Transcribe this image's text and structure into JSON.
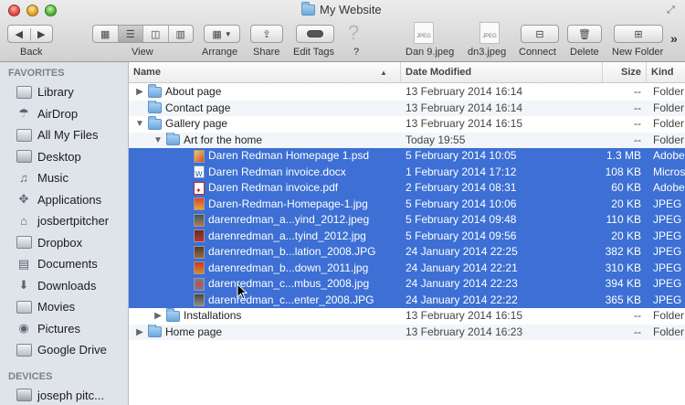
{
  "window": {
    "title": "My Website"
  },
  "toolbar": {
    "back_label": "Back",
    "view_label": "View",
    "arrange_label": "Arrange",
    "share_label": "Share",
    "tags_label": "Edit Tags",
    "help_label": "?",
    "thumb1_label": "Dan 9.jpeg",
    "thumb2_label": "dn3.jpeg",
    "connect_label": "Connect",
    "delete_label": "Delete",
    "newfolder_label": "New Folder",
    "more_glyph": "»"
  },
  "sidebar": {
    "favorites_heading": "FAVORITES",
    "devices_heading": "DEVICES",
    "items": [
      {
        "label": "Library",
        "icon": "folder-icon"
      },
      {
        "label": "AirDrop",
        "icon": "airdrop-icon"
      },
      {
        "label": "All My Files",
        "icon": "all-files-icon"
      },
      {
        "label": "Desktop",
        "icon": "desktop-icon"
      },
      {
        "label": "Music",
        "icon": "music-icon"
      },
      {
        "label": "Applications",
        "icon": "applications-icon"
      },
      {
        "label": "josbertpitcher",
        "icon": "home-icon"
      },
      {
        "label": "Dropbox",
        "icon": "folder-icon"
      },
      {
        "label": "Documents",
        "icon": "documents-icon"
      },
      {
        "label": "Downloads",
        "icon": "downloads-icon"
      },
      {
        "label": "Movies",
        "icon": "movies-icon"
      },
      {
        "label": "Pictures",
        "icon": "pictures-icon"
      },
      {
        "label": "Google Drive",
        "icon": "folder-icon"
      }
    ],
    "devices": [
      {
        "label": "joseph pitc...",
        "icon": "computer-icon"
      }
    ]
  },
  "columns": {
    "name": "Name",
    "date": "Date Modified",
    "size": "Size",
    "kind": "Kind"
  },
  "rows": [
    {
      "name": "About page",
      "date": "13 February 2014 16:14",
      "size": "--",
      "kind": "Folder",
      "level": 0,
      "type": "folder",
      "disclosure": "closed",
      "selected": false
    },
    {
      "name": "Contact page",
      "date": "13 February 2014 16:14",
      "size": "--",
      "kind": "Folder",
      "level": 0,
      "type": "folder",
      "disclosure": "none",
      "selected": false
    },
    {
      "name": "Gallery page",
      "date": "13 February 2014 16:15",
      "size": "--",
      "kind": "Folder",
      "level": 0,
      "type": "folder",
      "disclosure": "open",
      "selected": false
    },
    {
      "name": "Art for the home",
      "date": "Today 19:55",
      "size": "--",
      "kind": "Folder",
      "level": 1,
      "type": "folder",
      "disclosure": "open",
      "selected": false
    },
    {
      "name": "Daren Redman Homepage 1.psd",
      "date": "5 February 2014 10:05",
      "size": "1.3 MB",
      "kind": "Adobe",
      "level": 2,
      "type": "psd",
      "selected": true
    },
    {
      "name": "Daren Redman invoice.docx",
      "date": "1 February 2014 17:12",
      "size": "108 KB",
      "kind": "Micros",
      "level": 2,
      "type": "docx",
      "selected": true
    },
    {
      "name": "Daren Redman invoice.pdf",
      "date": "2 February 2014 08:31",
      "size": "60 KB",
      "kind": "Adobe",
      "level": 2,
      "type": "pdf",
      "selected": true
    },
    {
      "name": "Daren-Redman-Homepage-1.jpg",
      "date": "5 February 2014 10:06",
      "size": "20 KB",
      "kind": "JPEG in",
      "level": 2,
      "type": "jpg1",
      "selected": true
    },
    {
      "name": "darenredman_a...yind_2012.jpeg",
      "date": "5 February 2014 09:48",
      "size": "110 KB",
      "kind": "JPEG in",
      "level": 2,
      "type": "jpg2",
      "selected": true
    },
    {
      "name": "darenredman_a...tyind_2012.jpg",
      "date": "5 February 2014 09:56",
      "size": "20 KB",
      "kind": "JPEG in",
      "level": 2,
      "type": "jpg3",
      "selected": true
    },
    {
      "name": "darenredman_b...lation_2008.JPG",
      "date": "24 January 2014 22:25",
      "size": "382 KB",
      "kind": "JPEG in",
      "level": 2,
      "type": "jpg4",
      "selected": true
    },
    {
      "name": "darenredman_b...down_2011.jpg",
      "date": "24 January 2014 22:21",
      "size": "310 KB",
      "kind": "JPEG in",
      "level": 2,
      "type": "jpg5",
      "selected": true
    },
    {
      "name": "darenredman_c...mbus_2008.jpg",
      "date": "24 January 2014 22:23",
      "size": "394 KB",
      "kind": "JPEG in",
      "level": 2,
      "type": "jpg7",
      "selected": true
    },
    {
      "name": "darenredman_c...enter_2008.JPG",
      "date": "24 January 2014 22:22",
      "size": "365 KB",
      "kind": "JPEG in",
      "level": 2,
      "type": "jpg8",
      "selected": true
    },
    {
      "name": "Installations",
      "date": "13 February 2014 16:15",
      "size": "--",
      "kind": "Folder",
      "level": 1,
      "type": "folder",
      "disclosure": "closed",
      "selected": false
    },
    {
      "name": "Home page",
      "date": "13 February 2014 16:23",
      "size": "--",
      "kind": "Folder",
      "level": 0,
      "type": "folder",
      "disclosure": "closed",
      "selected": false
    }
  ],
  "colors": {
    "selection": "#3d6fd4",
    "sidebar": "#dfe4ea",
    "folder": "#6ea7dd"
  }
}
